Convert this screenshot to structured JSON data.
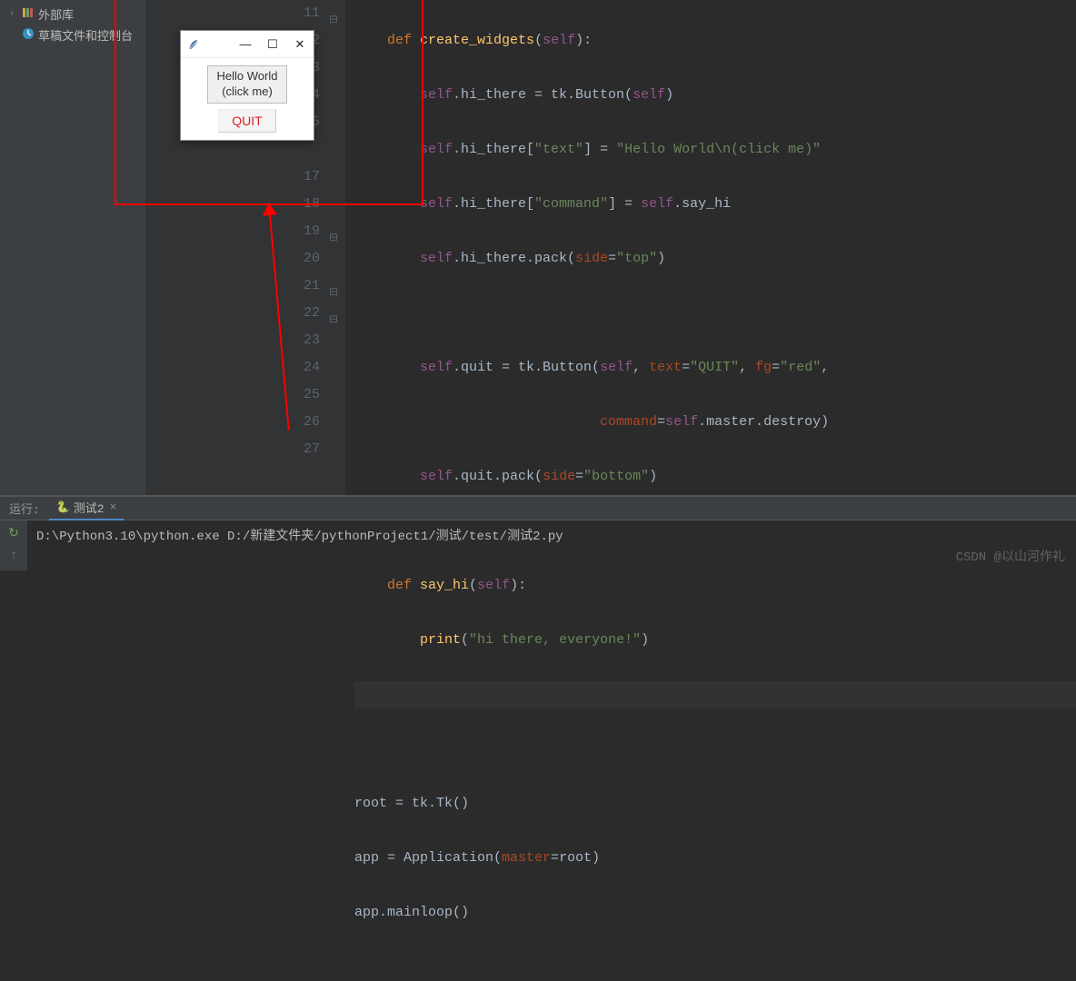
{
  "sidebar": {
    "external_libs": "外部库",
    "scratches": "草稿文件和控制台"
  },
  "gutter": {
    "lines": [
      "11",
      "12",
      "13",
      "14",
      "15",
      "",
      "17",
      "18",
      "19",
      "20",
      "21",
      "22",
      "23",
      "24",
      "25",
      "26",
      "27"
    ]
  },
  "code": {
    "l11_def": "def ",
    "l11_fn": "create_widgets",
    "l11_open": "(",
    "l11_self": "self",
    "l11_close": "):",
    "l12_self": "self",
    "l12_a": ".hi_there = tk.Button(",
    "l12_selfarg": "self",
    "l12_b": ")",
    "l13_self": "self",
    "l13_a": ".hi_there[",
    "l13_key": "\"text\"",
    "l13_b": "] = ",
    "l13_val": "\"Hello World\\n(click me)\"",
    "l14_self": "self",
    "l14_a": ".hi_there[",
    "l14_key": "\"command\"",
    "l14_b": "] = ",
    "l14_self2": "self",
    "l14_c": ".say_hi",
    "l15_self": "self",
    "l15_a": ".hi_there.pack(",
    "l15_side": "side",
    "l15_eq": "=",
    "l15_val": "\"top\"",
    "l15_close": ")",
    "l17_self": "self",
    "l17_a": ".quit = tk.Button(",
    "l17_selfarg": "self",
    "l17_b": ", ",
    "l17_text": "text",
    "l17_c": "=",
    "l17_textval": "\"QUIT\"",
    "l17_d": ", ",
    "l17_fg": "fg",
    "l17_e": "=",
    "l17_fgval": "\"red\"",
    "l17_f": ",",
    "l18_cmd": "command",
    "l18_eq": "=",
    "l18_self": "self",
    "l18_tail": ".master.destroy)",
    "l19_self": "self",
    "l19_a": ".quit.pack(",
    "l19_side": "side",
    "l19_eq": "=",
    "l19_val": "\"bottom\"",
    "l19_close": ")",
    "l21_def": "def ",
    "l21_fn": "say_hi",
    "l21_open": "(",
    "l21_self": "self",
    "l21_close": "):",
    "l22_print": "print",
    "l22_a": "(",
    "l22_str": "\"hi there, everyone!\"",
    "l22_b": ")",
    "l25": "root = tk.Tk()",
    "l26_a": "app = Application(",
    "l26_master": "master",
    "l26_eq": "=",
    "l26_root": "root)",
    "l27": "app.mainloop()"
  },
  "tk": {
    "hello_line1": "Hello World",
    "hello_line2": "(click me)",
    "quit": "QUIT"
  },
  "run": {
    "label": "运行:",
    "tab": "测试2",
    "output": "D:\\Python3.10\\python.exe D:/新建文件夹/pythonProject1/测试/test/测试2.py"
  },
  "watermark": "CSDN @以山河作礼"
}
